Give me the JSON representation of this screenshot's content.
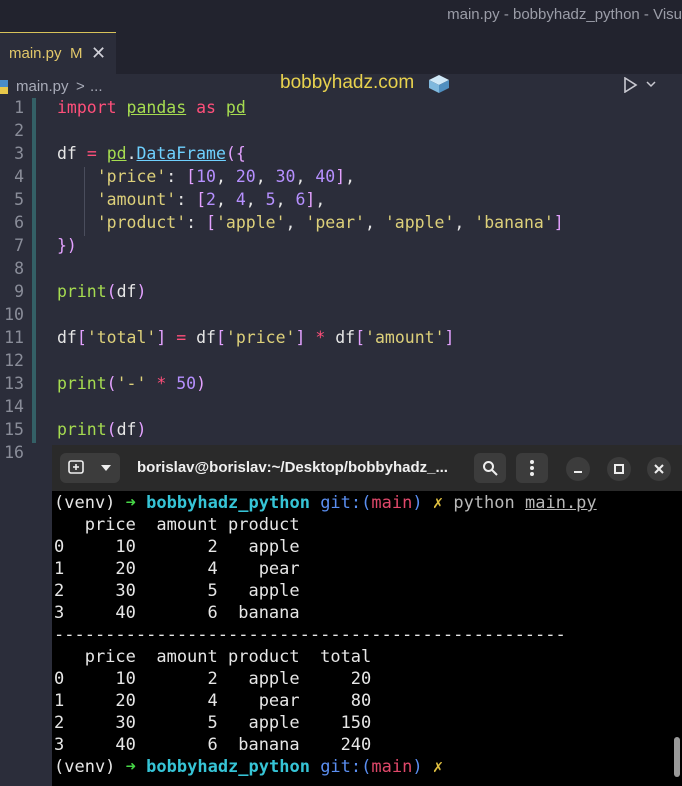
{
  "window": {
    "title": "main.py - bobbyhadz_python - Visu"
  },
  "tab": {
    "filename": "main.py",
    "modified": "M",
    "close": "✕"
  },
  "site": {
    "label": "bobbyhadz.com"
  },
  "breadcrumb": {
    "file": "main.py",
    "sep": ">",
    "more": "..."
  },
  "editor": {
    "line_numbers": [
      "1",
      "2",
      "3",
      "4",
      "5",
      "6",
      "7",
      "8",
      "9",
      "10",
      "11",
      "12",
      "13",
      "14",
      "15",
      "16"
    ]
  },
  "terminal": {
    "title": "borislav@borislav:~/Desktop/bobbyhadz_...",
    "prompt": {
      "venv": "(venv)",
      "arrow": "➜",
      "dir": "bobbyhadz_python",
      "git": "git:(",
      "branch": "main",
      "git_close": ")",
      "dirty": "✗",
      "cmd": "python",
      "arg": "main.py"
    },
    "output1": [
      "   price  amount product",
      "0     10       2   apple",
      "1     20       4    pear",
      "2     30       5   apple",
      "3     40       6  banana"
    ],
    "separator": "--------------------------------------------------",
    "output2": [
      "   price  amount product  total",
      "0     10       2   apple     20",
      "1     20       4    pear     80",
      "2     30       5   apple    150",
      "3     40       6  banana    240"
    ]
  },
  "colors": {
    "accent": "#e8d24e",
    "terminal_bg": "#000000",
    "editor_bg": "#2b2d3a"
  }
}
